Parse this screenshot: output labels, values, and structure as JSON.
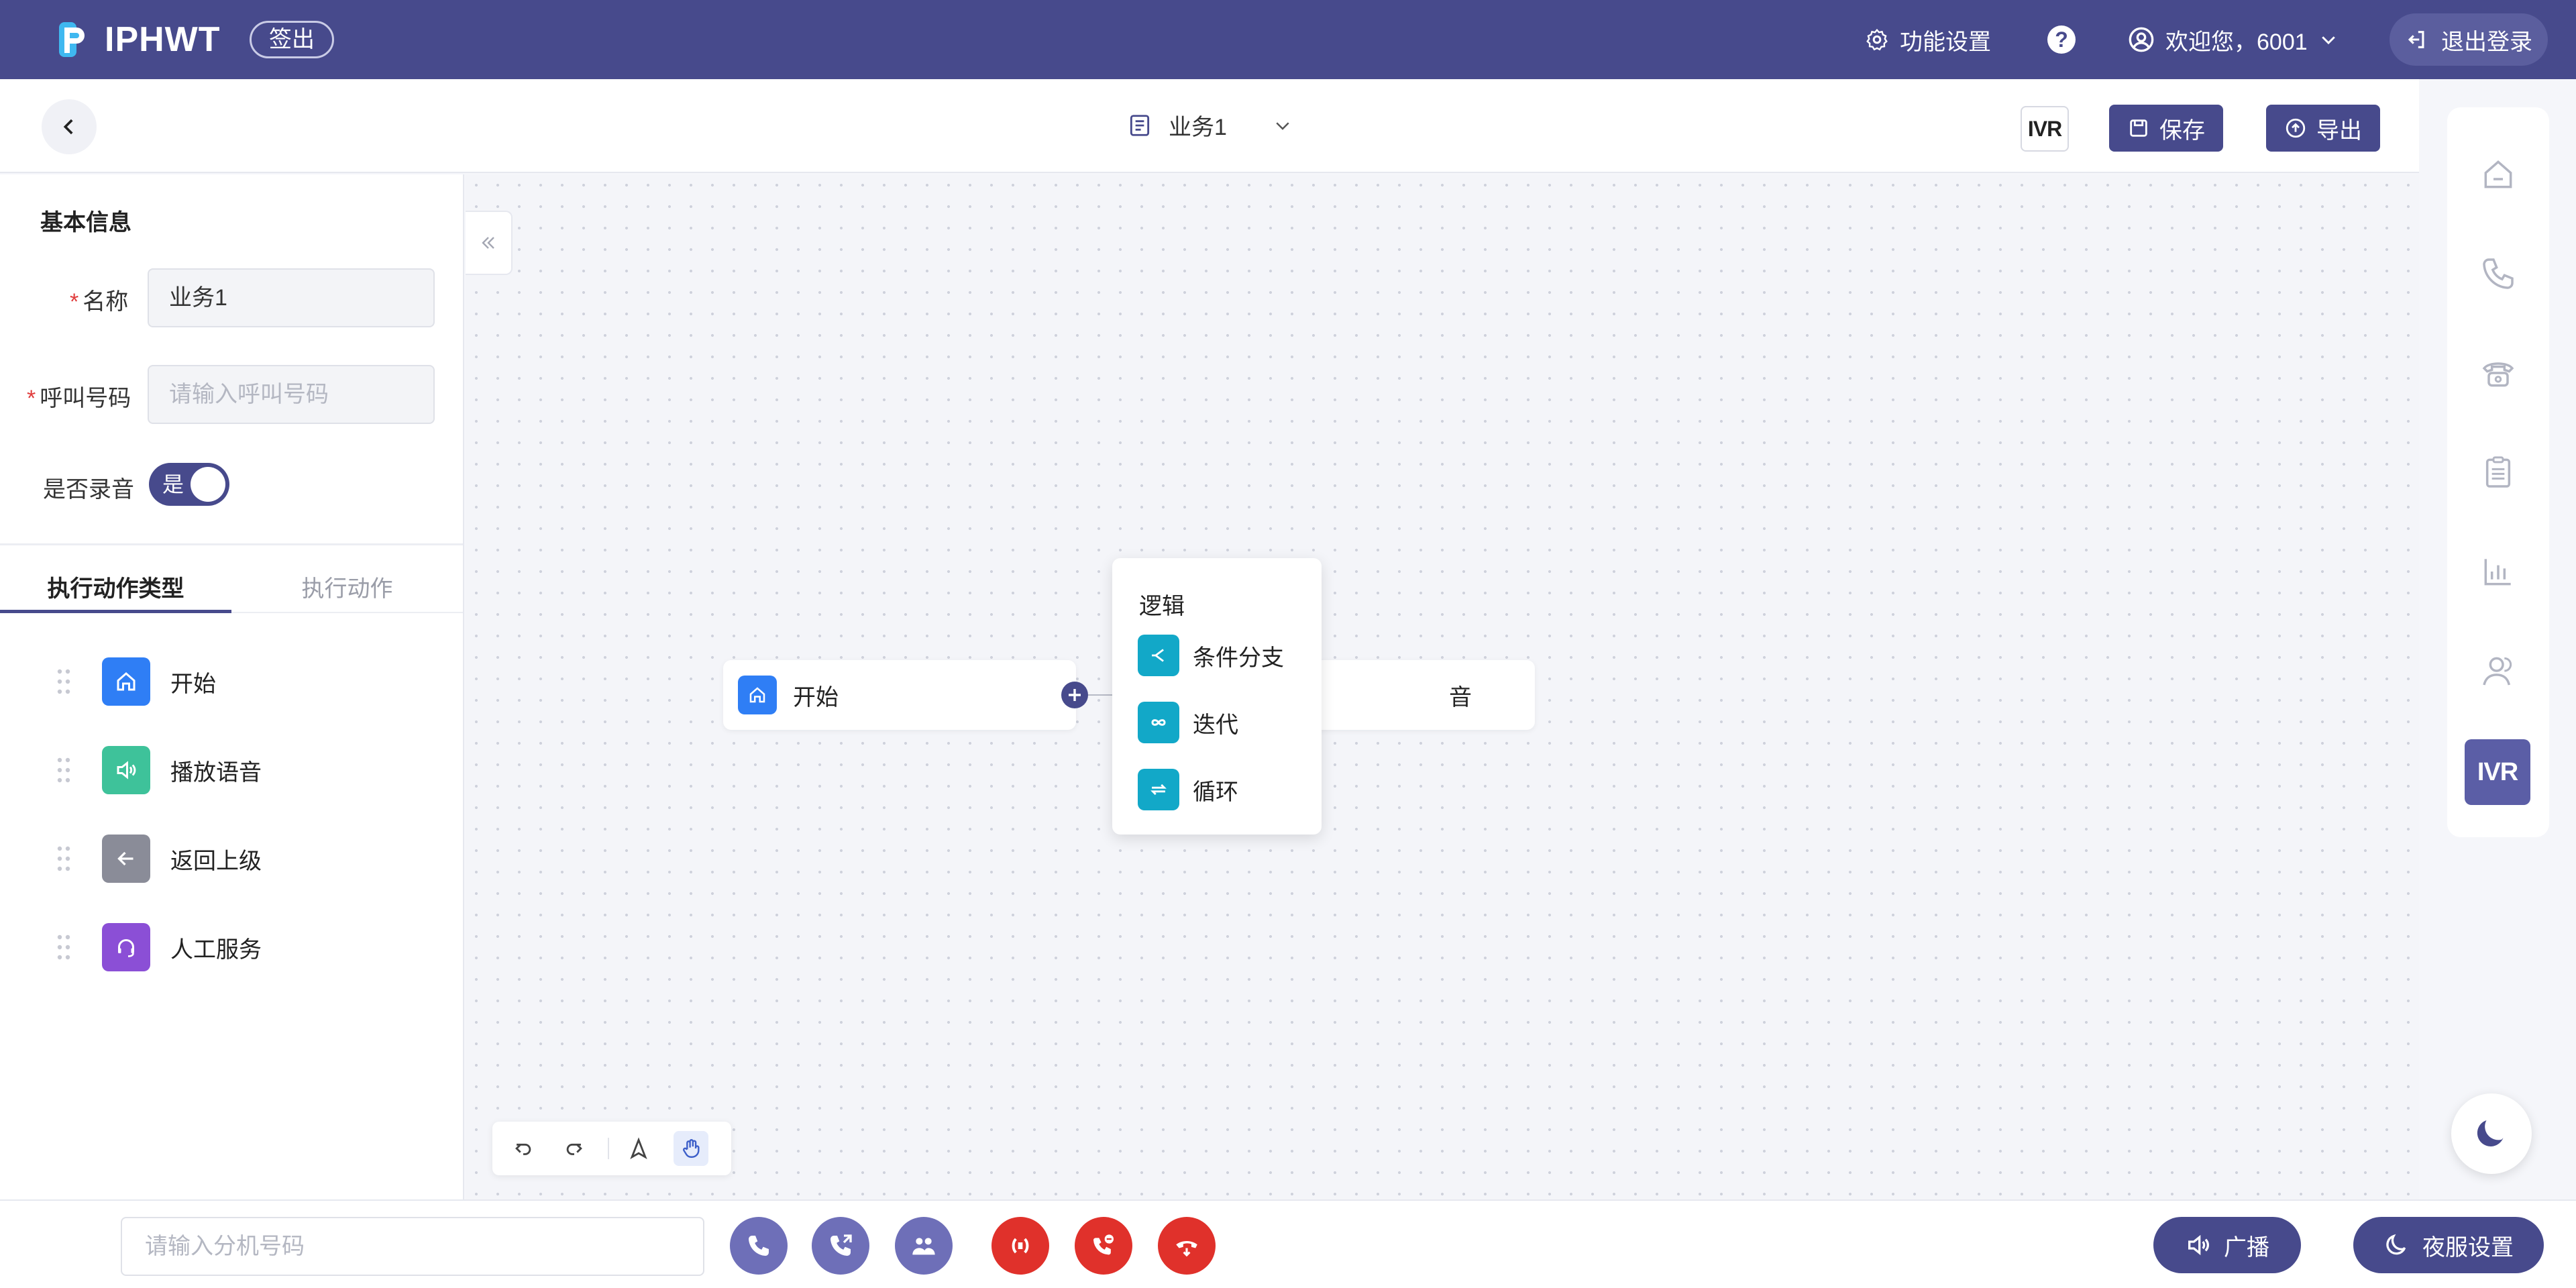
{
  "header": {
    "logo_text": "IPHWT",
    "signout_label": "签出",
    "settings_label": "功能设置",
    "help_label": "?",
    "welcome_label": "欢迎您，6001",
    "logout_label": "退出登录"
  },
  "toolbar": {
    "business_name": "业务1",
    "ivr_label": "IVR",
    "save_label": "保存",
    "export_label": "导出"
  },
  "left_panel": {
    "section_title": "基本信息",
    "name_label": "名称",
    "name_value": "业务1",
    "number_label": "呼叫号码",
    "number_placeholder": "请输入呼叫号码",
    "record_label": "是否录音",
    "record_toggle_text": "是",
    "tabs": [
      {
        "label": "执行动作类型",
        "active": true
      },
      {
        "label": "执行动作",
        "active": false
      }
    ],
    "actions": [
      {
        "label": "开始",
        "icon": "home-icon",
        "color": "#2f7ef5"
      },
      {
        "label": "播放语音",
        "icon": "speaker-icon",
        "color": "#3ec29a"
      },
      {
        "label": "返回上级",
        "icon": "back-arrow-icon",
        "color": "#8a8c98"
      },
      {
        "label": "人工服务",
        "icon": "headset-icon",
        "color": "#8b4fd6"
      }
    ]
  },
  "canvas": {
    "start_node_label": "开始",
    "second_node_label": "音",
    "popover": {
      "title": "逻辑",
      "items": [
        {
          "label": "条件分支",
          "icon": "branch-icon"
        },
        {
          "label": "迭代",
          "icon": "infinity-icon"
        },
        {
          "label": "循环",
          "icon": "loop-icon"
        }
      ]
    }
  },
  "right_rail": {
    "items": [
      "home-icon",
      "phone-icon",
      "desk-phone-icon",
      "clipboard-icon",
      "bar-chart-icon",
      "user-icon"
    ],
    "active_label": "IVR"
  },
  "bottom_bar": {
    "extension_placeholder": "请输入分机号码",
    "broadcast_label": "广播",
    "night_label": "夜服设置"
  },
  "colors": {
    "primary": "#474a8c",
    "danger": "#e0312b",
    "teal": "#12a8c8"
  }
}
